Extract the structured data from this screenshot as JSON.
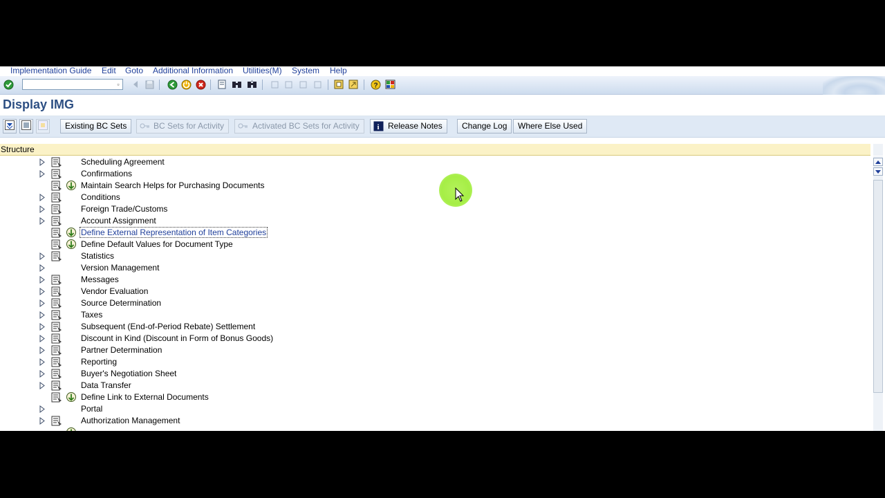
{
  "menu": [
    "Implementation Guide",
    "Edit",
    "Goto",
    "Additional Information",
    "Utilities(M)",
    "System",
    "Help"
  ],
  "title": "Display IMG",
  "app_toolbar": {
    "existing_bc_sets": "Existing BC Sets",
    "bc_sets_for_activity": "BC Sets for Activity",
    "activated_bc_sets": "Activated BC Sets for Activity",
    "release_notes": "Release Notes",
    "change_log": "Change Log",
    "where_else_used": "Where Else Used"
  },
  "structure_header": "Structure",
  "tree": [
    {
      "label": "Scheduling Agreement",
      "expand": true,
      "doc": true,
      "exec": false
    },
    {
      "label": "Confirmations",
      "expand": true,
      "doc": true,
      "exec": false
    },
    {
      "label": "Maintain Search Helps for Purchasing Documents",
      "expand": false,
      "doc": true,
      "exec": true
    },
    {
      "label": "Conditions",
      "expand": true,
      "doc": true,
      "exec": false
    },
    {
      "label": "Foreign Trade/Customs",
      "expand": true,
      "doc": true,
      "exec": false
    },
    {
      "label": "Account Assignment",
      "expand": true,
      "doc": true,
      "exec": false
    },
    {
      "label": "Define External Representation of Item Categories",
      "expand": false,
      "doc": true,
      "exec": true,
      "selected": true
    },
    {
      "label": "Define Default Values for Document Type",
      "expand": false,
      "doc": true,
      "exec": true
    },
    {
      "label": "Statistics",
      "expand": true,
      "doc": true,
      "exec": false
    },
    {
      "label": "Version Management",
      "expand": true,
      "doc": false,
      "exec": false
    },
    {
      "label": "Messages",
      "expand": true,
      "doc": true,
      "exec": false
    },
    {
      "label": "Vendor Evaluation",
      "expand": true,
      "doc": true,
      "exec": false
    },
    {
      "label": "Source Determination",
      "expand": true,
      "doc": true,
      "exec": false
    },
    {
      "label": "Taxes",
      "expand": true,
      "doc": true,
      "exec": false
    },
    {
      "label": "Subsequent (End-of-Period Rebate) Settlement",
      "expand": true,
      "doc": true,
      "exec": false
    },
    {
      "label": "Discount in Kind (Discount in Form of Bonus Goods)",
      "expand": true,
      "doc": true,
      "exec": false
    },
    {
      "label": "Partner Determination",
      "expand": true,
      "doc": true,
      "exec": false
    },
    {
      "label": "Reporting",
      "expand": true,
      "doc": true,
      "exec": false
    },
    {
      "label": "Buyer's Negotiation Sheet",
      "expand": true,
      "doc": true,
      "exec": false
    },
    {
      "label": "Data Transfer",
      "expand": true,
      "doc": true,
      "exec": false
    },
    {
      "label": "Define Link to External Documents",
      "expand": false,
      "doc": true,
      "exec": true
    },
    {
      "label": "Portal",
      "expand": true,
      "doc": false,
      "exec": false
    },
    {
      "label": "Authorization Management",
      "expand": true,
      "doc": true,
      "exec": false
    },
    {
      "label": "",
      "expand": false,
      "doc": false,
      "exec": true
    }
  ],
  "colors": {
    "menu_text": "#1f3f9a",
    "title": "#2d4f83",
    "header_bg": "#fbf2c7",
    "cursor_highlight": "#a6ee46"
  }
}
